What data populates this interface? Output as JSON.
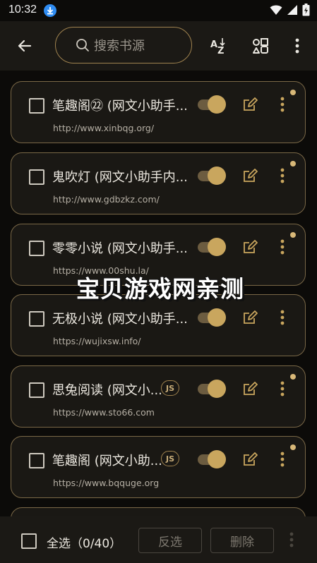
{
  "status_bar": {
    "time": "10:32"
  },
  "toolbar": {
    "search_placeholder": "搜索书源"
  },
  "sources": [
    {
      "title": "笔趣阁㉒ (网文小助手...",
      "url": "http://www.xinbqg.org/",
      "js": false,
      "enabled": true,
      "dot": true
    },
    {
      "title": "鬼吹灯 (网文小助手内...",
      "url": "http://www.gdbzkz.com/",
      "js": false,
      "enabled": true,
      "dot": true
    },
    {
      "title": "零零小说 (网文小助手...",
      "url": "https://www.00shu.la/",
      "js": false,
      "enabled": true,
      "dot": true
    },
    {
      "title": "无极小说 (网文小助手...",
      "url": "https://wujixsw.info/",
      "js": false,
      "enabled": true,
      "dot": false
    },
    {
      "title": "思兔阅读 (网文小...",
      "url": "https://www.sto66.com",
      "js": true,
      "js_label": "JS",
      "enabled": true,
      "dot": true
    },
    {
      "title": "笔趣阁 (网文小助...",
      "url": "https://www.bqquge.org",
      "js": true,
      "js_label": "JS",
      "enabled": true,
      "dot": true
    }
  ],
  "watermark": "宝贝游戏网亲测",
  "bottom_bar": {
    "select_all_label": "全选（0/40）",
    "invert_label": "反选",
    "delete_label": "删除"
  },
  "colors": {
    "accent": "#c9a65e",
    "border": "#7a6847",
    "background": "#0c0b09"
  }
}
